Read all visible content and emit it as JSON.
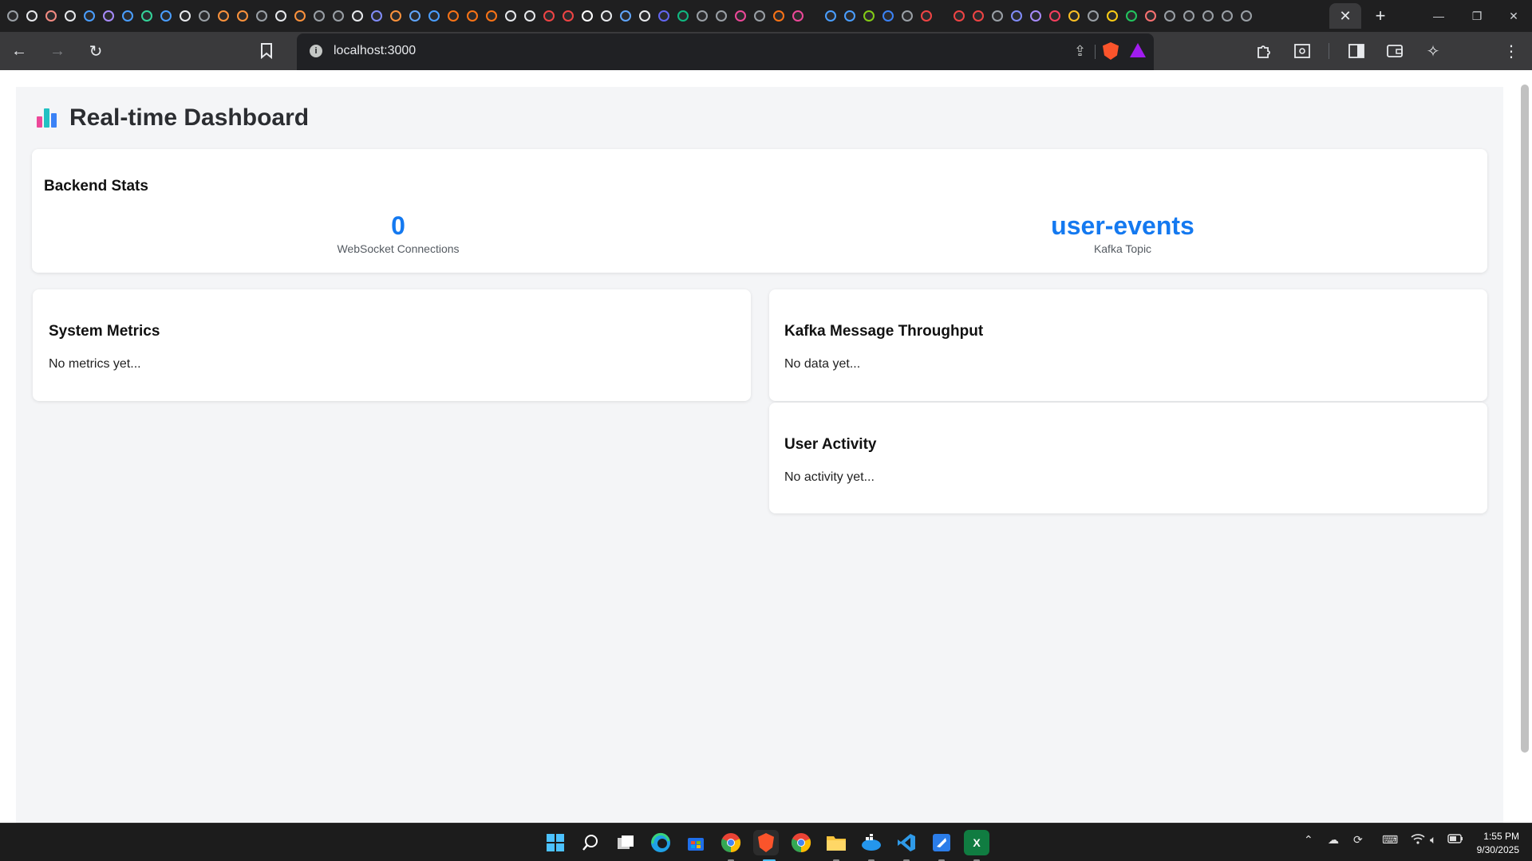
{
  "browser": {
    "url": "localhost:3000",
    "active_tab_close": "✕",
    "new_tab": "+",
    "pinned_tab_colors": [
      "#9aa0a6",
      "#e8eaed",
      "#f28b82",
      "#e8eaed",
      "#4a9eff",
      "#a78bfa",
      "#4a9eff",
      "#34d399",
      "#4a9eff",
      "#e8eaed",
      "#9aa0a6",
      "#fb923c",
      "#fb923c",
      "#9aa0a6",
      "#e8eaed",
      "#fb923c",
      "#9aa0a6",
      "#9aa0a6",
      "#e8eaed",
      "#818cf8",
      "#fb923c",
      "#60a5fa",
      "#4a9eff",
      "#f97316",
      "#f97316",
      "#f97316",
      "#e8eaed",
      "#e8eaed",
      "#ef4444",
      "#ef4444",
      "#ffffff",
      "#e8eaed",
      "#60a5fa",
      "#e8eaed",
      "#6366f1",
      "#10b981",
      "#9aa0a6",
      "#9aa0a6",
      "#ec4899",
      "#9aa0a6",
      "#f97316",
      "#ec4899"
    ],
    "pinned_tab_colors_2": [
      "#4a9eff",
      "#4a9eff",
      "#84cc16",
      "#3b82f6",
      "#9aa0a6",
      "#ef4444"
    ],
    "pinned_tab_colors_3": [
      "#ef4444",
      "#ef4444",
      "#9aa0a6",
      "#818cf8",
      "#a78bfa",
      "#f43f5e",
      "#fbbf24",
      "#9aa0a6",
      "#facc15",
      "#22c55e",
      "#f87171",
      "#9aa0a6",
      "#9aa0a6",
      "#9aa0a6",
      "#9aa0a6",
      "#9aa0a6"
    ]
  },
  "dashboard": {
    "title": "Real-time Dashboard",
    "backend_stats": {
      "heading": "Backend Stats",
      "stats": [
        {
          "value": "0",
          "label": "WebSocket Connections"
        },
        {
          "value": "user-events",
          "label": "Kafka Topic"
        }
      ]
    },
    "system_metrics": {
      "heading": "System Metrics",
      "empty_text": "No metrics yet..."
    },
    "kafka_throughput": {
      "heading": "Kafka Message Throughput",
      "empty_text": "No data yet..."
    },
    "user_activity": {
      "heading": "User Activity",
      "empty_text": "No activity yet..."
    },
    "accent_color": "#1479f0"
  },
  "taskbar": {
    "excel_label": "X",
    "time": "1:55 PM",
    "date": "9/30/2025"
  }
}
